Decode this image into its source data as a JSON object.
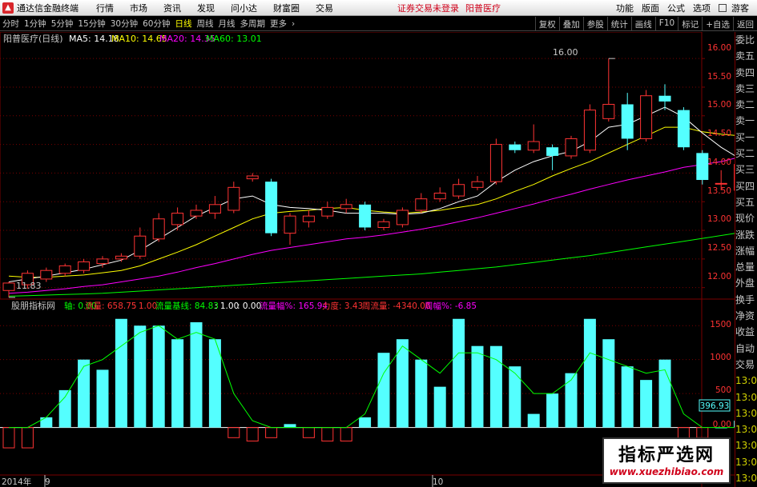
{
  "menubar": {
    "app_title": "通达信金融终端",
    "menus": [
      "行情",
      "市场",
      "资讯",
      "发现",
      "问小达",
      "财富圈",
      "交易"
    ],
    "notice": "证券交易未登录",
    "stock_name": "阳普医疗",
    "right_menus": [
      "功能",
      "版面",
      "公式",
      "选项"
    ],
    "guest": "游客"
  },
  "toolbar": {
    "periods": [
      "分时",
      "1分钟",
      "5分钟",
      "15分钟",
      "30分钟",
      "60分钟",
      "日线",
      "周线",
      "月线",
      "多周期",
      "更多"
    ],
    "active_period": "日线",
    "right_buttons": [
      "复权",
      "叠加",
      "参股",
      "统计",
      "画线",
      "F10",
      "标记",
      "+自选",
      "返回"
    ]
  },
  "main_chart": {
    "title": "阳普医疗(日线)",
    "ma_legend": [
      {
        "label": "MA5: 14.18",
        "color": "#ffffff"
      },
      {
        "label": "MA10: 14.65",
        "color": "#ffff00"
      },
      {
        "label": "MA20: 14.35",
        "color": "#ff00ff"
      },
      {
        "label": "MA60: 13.01",
        "color": "#00ff00"
      }
    ],
    "high_label": "16.00",
    "low_label": "11.83",
    "y_ticks": [
      "16.00",
      "15.50",
      "15.00",
      "14.50",
      "14.00",
      "13.50",
      "13.00",
      "12.50",
      "12.00"
    ]
  },
  "sub_chart": {
    "title": "股朋指标网",
    "legend": [
      {
        "label": "轴: 0.00",
        "color": "#00ff00"
      },
      {
        "label": "流量: 658.75",
        "color": "#ff3333"
      },
      {
        "label": ": 1.00",
        "color": "#ff3333"
      },
      {
        "label": "流量基线: 84.83",
        "color": "#00ff00"
      },
      {
        "label": ": 1.00",
        "color": "#ffffff"
      },
      {
        "label": ": 0.00",
        "color": "#ffffff"
      },
      {
        "label": "流量幅%: 165.94",
        "color": "#ff00ff"
      },
      {
        "label": "力度: 3.43",
        "color": "#ff3333"
      },
      {
        "label": "周流量: -4340.06",
        "color": "#ff3333"
      },
      {
        "label": "周幅%: -6.85",
        "color": "#ff00ff"
      }
    ],
    "y_ticks": [
      "1500",
      "1000",
      "500",
      "0.00"
    ],
    "current_value": "396.93"
  },
  "x_axis": {
    "labels": [
      "2014年",
      "9",
      "10"
    ]
  },
  "right_panel": {
    "labels": [
      "委比",
      "卖五",
      "卖四",
      "卖三",
      "卖二",
      "卖一",
      "买一",
      "买二",
      "买三",
      "买四",
      "买五",
      "现价",
      "涨跌",
      "涨幅",
      "总量",
      "外盘",
      "换手",
      "净资",
      "收益",
      "自动",
      "交易",
      "13:0",
      "13:0",
      "13:0",
      "13:0",
      "13:0",
      "13:0",
      "13:0"
    ]
  },
  "watermark": {
    "title": "指标严选网",
    "url": "www.xuezhibiao.com"
  },
  "colors": {
    "up": "#ff3333",
    "down": "#54ffff",
    "grid": "#7a0000",
    "ma5": "#ffffff",
    "ma10": "#ffff00",
    "ma20": "#ff00ff",
    "ma60": "#00ff00"
  },
  "chart_data": {
    "type": "candlestick",
    "price_range": [
      11.8,
      16.1
    ],
    "candles": [
      {
        "o": 11.95,
        "c": 12.08,
        "h": 12.1,
        "l": 11.83
      },
      {
        "o": 12.05,
        "c": 12.25,
        "h": 12.3,
        "l": 11.98
      },
      {
        "o": 12.15,
        "c": 12.3,
        "h": 12.35,
        "l": 12.1
      },
      {
        "o": 12.25,
        "c": 12.38,
        "h": 12.42,
        "l": 12.2
      },
      {
        "o": 12.3,
        "c": 12.45,
        "h": 12.5,
        "l": 12.25
      },
      {
        "o": 12.42,
        "c": 12.5,
        "h": 12.55,
        "l": 12.35
      },
      {
        "o": 12.5,
        "c": 12.55,
        "h": 12.6,
        "l": 12.45
      },
      {
        "o": 12.55,
        "c": 12.9,
        "h": 13.05,
        "l": 12.5
      },
      {
        "o": 12.85,
        "c": 13.2,
        "h": 13.3,
        "l": 12.8
      },
      {
        "o": 13.1,
        "c": 13.3,
        "h": 13.4,
        "l": 13.0
      },
      {
        "o": 13.25,
        "c": 13.35,
        "h": 13.45,
        "l": 13.2
      },
      {
        "o": 13.3,
        "c": 13.45,
        "h": 13.6,
        "l": 13.2
      },
      {
        "o": 13.35,
        "c": 13.75,
        "h": 13.85,
        "l": 13.3
      },
      {
        "o": 13.9,
        "c": 13.95,
        "h": 14.0,
        "l": 13.85
      },
      {
        "o": 13.85,
        "c": 12.95,
        "h": 13.9,
        "l": 12.9
      },
      {
        "o": 12.95,
        "c": 13.25,
        "h": 13.3,
        "l": 12.75
      },
      {
        "o": 13.15,
        "c": 13.25,
        "h": 13.35,
        "l": 13.05
      },
      {
        "o": 13.25,
        "c": 13.4,
        "h": 13.5,
        "l": 13.2
      },
      {
        "o": 13.38,
        "c": 13.45,
        "h": 13.55,
        "l": 13.3
      },
      {
        "o": 13.45,
        "c": 13.05,
        "h": 13.5,
        "l": 13.0
      },
      {
        "o": 13.05,
        "c": 13.15,
        "h": 13.2,
        "l": 13.0
      },
      {
        "o": 13.1,
        "c": 13.35,
        "h": 13.4,
        "l": 13.05
      },
      {
        "o": 13.35,
        "c": 13.55,
        "h": 13.65,
        "l": 13.3
      },
      {
        "o": 13.55,
        "c": 13.65,
        "h": 13.75,
        "l": 13.5
      },
      {
        "o": 13.6,
        "c": 13.8,
        "h": 13.9,
        "l": 13.55
      },
      {
        "o": 13.75,
        "c": 13.85,
        "h": 13.95,
        "l": 13.7
      },
      {
        "o": 13.85,
        "c": 14.5,
        "h": 14.6,
        "l": 13.8
      },
      {
        "o": 14.5,
        "c": 14.4,
        "h": 14.55,
        "l": 14.35
      },
      {
        "o": 14.4,
        "c": 14.55,
        "h": 14.85,
        "l": 14.35
      },
      {
        "o": 14.45,
        "c": 14.3,
        "h": 14.5,
        "l": 14.05
      },
      {
        "o": 14.3,
        "c": 14.6,
        "h": 14.65,
        "l": 14.25
      },
      {
        "o": 14.4,
        "c": 15.1,
        "h": 15.2,
        "l": 14.35
      },
      {
        "o": 14.95,
        "c": 15.2,
        "h": 16.0,
        "l": 14.9
      },
      {
        "o": 15.2,
        "c": 14.6,
        "h": 15.4,
        "l": 14.4
      },
      {
        "o": 14.6,
        "c": 15.35,
        "h": 15.45,
        "l": 14.55
      },
      {
        "o": 15.35,
        "c": 15.25,
        "h": 15.55,
        "l": 15.1
      },
      {
        "o": 15.1,
        "c": 14.45,
        "h": 15.15,
        "l": 14.4
      },
      {
        "o": 14.35,
        "c": 13.88,
        "h": 14.4,
        "l": 13.8
      },
      {
        "o": 13.82,
        "c": 13.82,
        "h": 14.05,
        "l": 13.7
      },
      {
        "o": 13.7,
        "c": 14.15,
        "h": 14.2,
        "l": 13.45
      },
      {
        "o": 14.2,
        "c": 14.6,
        "h": 14.65,
        "l": 14.15
      }
    ],
    "ma5": [
      12.1,
      12.15,
      12.2,
      12.26,
      12.32,
      12.4,
      12.48,
      12.65,
      12.85,
      13.05,
      13.25,
      13.4,
      13.55,
      13.6,
      13.45,
      13.4,
      13.38,
      13.35,
      13.3,
      13.3,
      13.3,
      13.28,
      13.3,
      13.38,
      13.5,
      13.6,
      13.85,
      14.05,
      14.2,
      14.3,
      14.38,
      14.55,
      14.8,
      14.85,
      15.0,
      15.15,
      14.98,
      14.7,
      14.45,
      14.25,
      14.18
    ],
    "ma10": [
      12.2,
      12.18,
      12.18,
      12.2,
      12.22,
      12.26,
      12.3,
      12.38,
      12.5,
      12.62,
      12.75,
      12.9,
      13.05,
      13.2,
      13.3,
      13.33,
      13.35,
      13.38,
      13.4,
      13.35,
      13.32,
      13.3,
      13.32,
      13.35,
      13.4,
      13.45,
      13.55,
      13.68,
      13.8,
      13.95,
      14.08,
      14.2,
      14.35,
      14.5,
      14.65,
      14.8,
      14.8,
      14.72,
      14.68,
      14.65,
      14.65
    ],
    "ma20": [
      11.9,
      11.92,
      11.95,
      11.98,
      12.02,
      12.05,
      12.1,
      12.15,
      12.2,
      12.27,
      12.35,
      12.42,
      12.5,
      12.58,
      12.65,
      12.7,
      12.75,
      12.8,
      12.85,
      12.88,
      12.92,
      12.97,
      13.02,
      13.08,
      13.15,
      13.22,
      13.3,
      13.38,
      13.46,
      13.55,
      13.63,
      13.72,
      13.8,
      13.88,
      13.95,
      14.02,
      14.1,
      14.15,
      14.2,
      14.28,
      14.35
    ],
    "ma60": [
      11.85,
      11.86,
      11.87,
      11.88,
      11.89,
      11.9,
      11.92,
      11.94,
      11.96,
      11.98,
      12.0,
      12.02,
      12.04,
      12.06,
      12.08,
      12.1,
      12.12,
      12.14,
      12.16,
      12.18,
      12.2,
      12.22,
      12.24,
      12.27,
      12.3,
      12.33,
      12.36,
      12.4,
      12.44,
      12.48,
      12.52,
      12.56,
      12.61,
      12.66,
      12.71,
      12.76,
      12.81,
      12.86,
      12.91,
      12.96,
      13.01
    ],
    "flow_bars": [
      -300,
      -300,
      150,
      550,
      1000,
      850,
      1600,
      1500,
      1500,
      1300,
      1550,
      1300,
      -150,
      -200,
      -150,
      50,
      -150,
      -200,
      -200,
      150,
      1100,
      1300,
      1000,
      600,
      1600,
      1200,
      1200,
      900,
      200,
      500,
      800,
      1600,
      1300,
      900,
      700,
      1000,
      -300,
      -150,
      0,
      100,
      550
    ],
    "flow_baseline": [
      0,
      0,
      150,
      450,
      900,
      1000,
      1200,
      1400,
      1500,
      1300,
      1400,
      1300,
      500,
      100,
      0,
      0,
      0,
      0,
      0,
      200,
      800,
      1200,
      1000,
      800,
      1100,
      1100,
      1000,
      800,
      500,
      500,
      700,
      1100,
      1000,
      900,
      800,
      850,
      200,
      0,
      0,
      0,
      100
    ],
    "flow_range": [
      -700,
      1750
    ]
  }
}
